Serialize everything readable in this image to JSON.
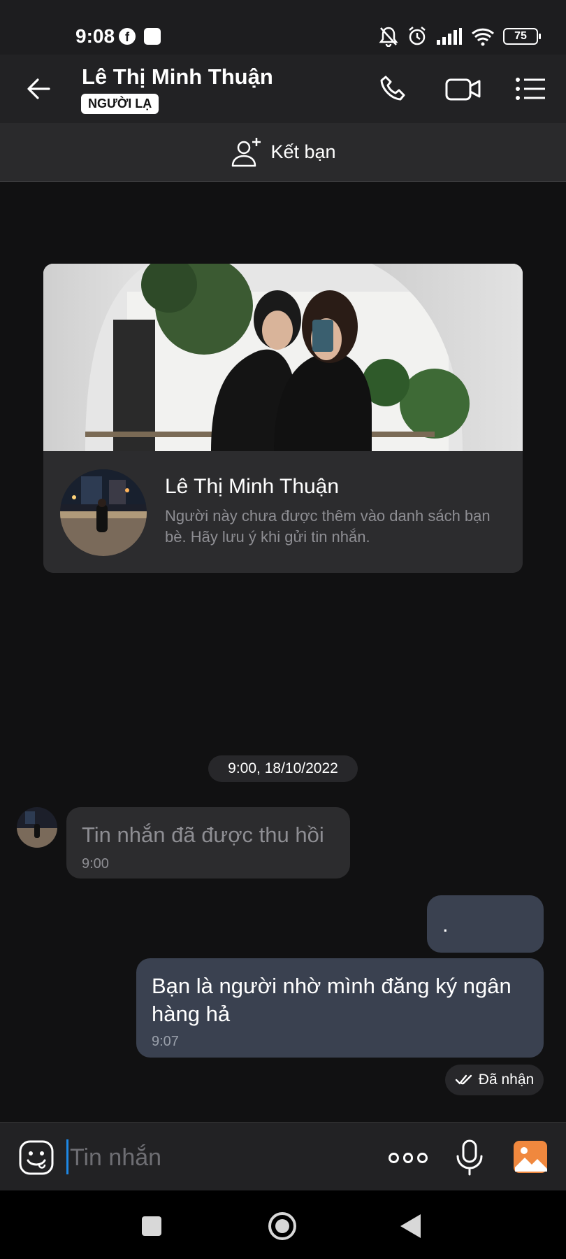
{
  "status_bar": {
    "time": "9:08",
    "battery": "75"
  },
  "header": {
    "title": "Lê Thị Minh Thuận",
    "badge": "NGƯỜI LẠ"
  },
  "add_friend": {
    "label": "Kết bạn"
  },
  "profile_card": {
    "name": "Lê Thị Minh Thuận",
    "description": "Người này chưa được thêm vào danh sách bạn bè. Hãy lưu ý khi gửi tin nhắn."
  },
  "chat": {
    "date_separator": "9:00, 18/10/2022",
    "messages": [
      {
        "direction": "in",
        "text": "Tin nhắn đã được thu hồi",
        "time": "9:00",
        "recalled": true
      },
      {
        "direction": "out",
        "text": ".",
        "time": ""
      },
      {
        "direction": "out",
        "text": "Bạn là người nhờ mình đăng ký ngân hàng hả",
        "time": "9:07"
      }
    ],
    "delivery_status": "Đã nhận"
  },
  "input": {
    "placeholder": "Tin nhắn"
  },
  "colors": {
    "outgoing_bubble": "#3a4150",
    "incoming_bubble": "#2c2c2e",
    "background": "#111112",
    "caret": "#1e88e5",
    "image_button": "#f0883e"
  },
  "icons": [
    "facebook-icon",
    "mute-icon",
    "alarm-icon",
    "signal-icon",
    "wifi-icon",
    "battery-icon",
    "back-arrow-icon",
    "phone-icon",
    "video-camera-icon",
    "list-menu-icon",
    "add-friend-icon",
    "double-check-icon",
    "sticker-icon",
    "more-icon",
    "microphone-icon",
    "image-icon"
  ]
}
